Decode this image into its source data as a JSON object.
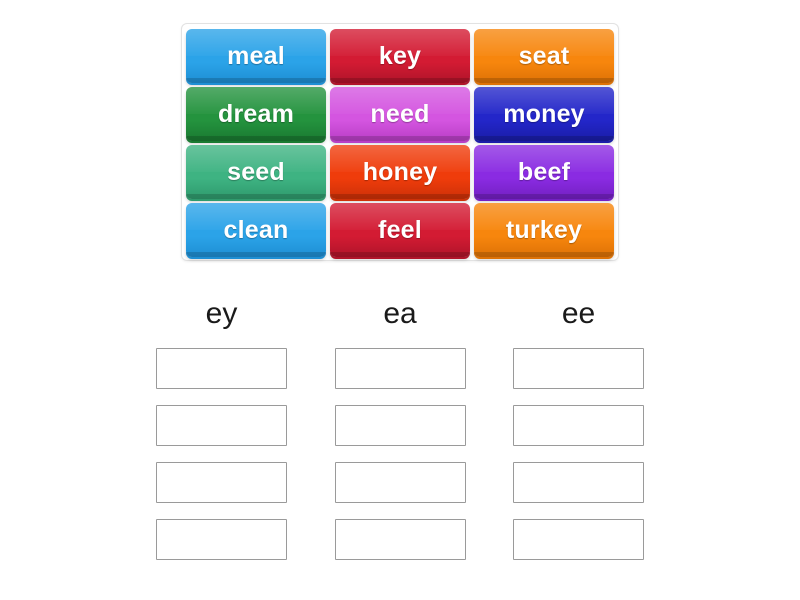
{
  "activity": {
    "type": "group-sort",
    "tray": {
      "name": "word-tile-tray",
      "tiles": [
        {
          "label": "meal",
          "color": "#2ba3e8",
          "shade": "#1e8fd4"
        },
        {
          "label": "key",
          "color": "#d31b33",
          "shade": "#b0142a"
        },
        {
          "label": "seat",
          "color": "#f7860d",
          "shade": "#de7206"
        },
        {
          "label": "dream",
          "color": "#24933e",
          "shade": "#1a7a31"
        },
        {
          "label": "need",
          "color": "#d455e0",
          "shade": "#b93ec6"
        },
        {
          "label": "money",
          "color": "#2326c9",
          "shade": "#1a1da8"
        },
        {
          "label": "seed",
          "color": "#3eb382",
          "shade": "#2f9a6d"
        },
        {
          "label": "honey",
          "color": "#ef3c0b",
          "shade": "#cd3108"
        },
        {
          "label": "beef",
          "color": "#8a2be2",
          "shade": "#7320c2"
        },
        {
          "label": "clean",
          "color": "#2ba3e8",
          "shade": "#1e8fd4"
        },
        {
          "label": "feel",
          "color": "#d31b33",
          "shade": "#b0142a"
        },
        {
          "label": "turkey",
          "color": "#f7860d",
          "shade": "#de7206"
        }
      ]
    },
    "columns": [
      {
        "header": "ey",
        "slots": [
          "",
          "",
          "",
          ""
        ]
      },
      {
        "header": "ea",
        "slots": [
          "",
          "",
          "",
          ""
        ]
      },
      {
        "header": "ee",
        "slots": [
          "",
          "",
          "",
          ""
        ]
      }
    ]
  }
}
